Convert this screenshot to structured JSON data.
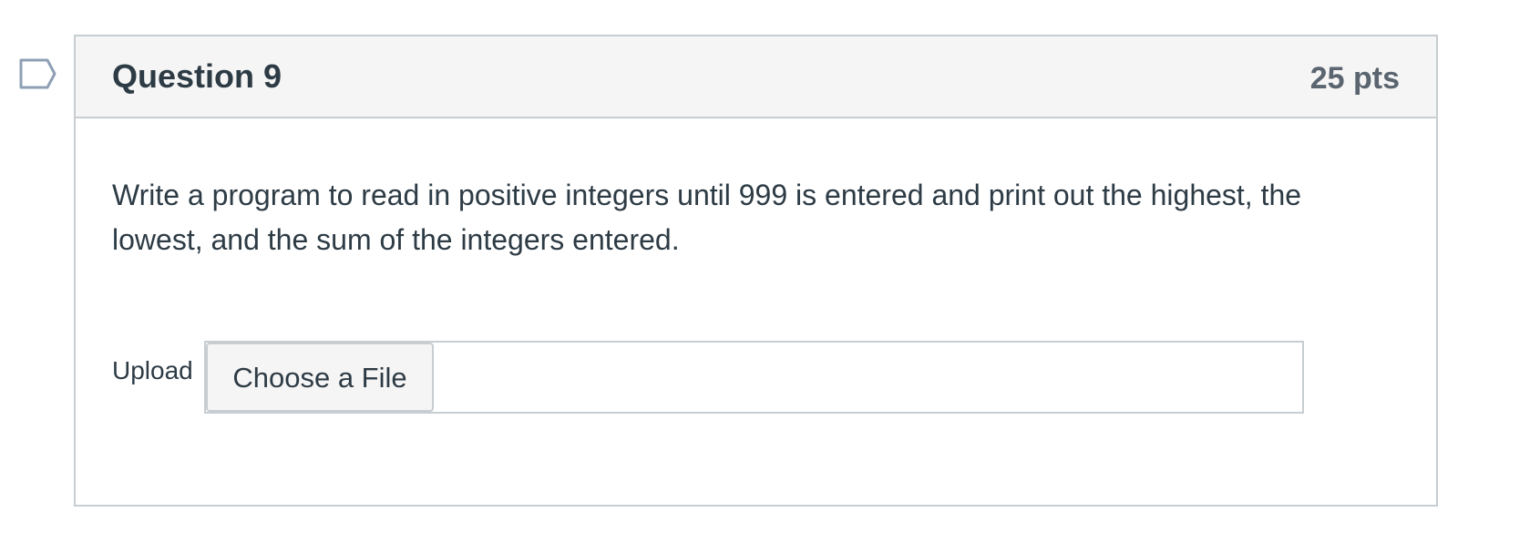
{
  "question": {
    "title": "Question 9",
    "points": "25 pts",
    "text": "Write a program to read in positive integers until 999 is entered and print out the highest, the lowest, and the sum of the integers entered.",
    "flag_icon": "bookmark-flag-icon"
  },
  "upload": {
    "label": "Upload",
    "button_label": "Choose a File"
  },
  "colors": {
    "text": "#2d3b45",
    "muted": "#5a6570",
    "border": "#c7cdd1",
    "header_bg": "#f5f5f5",
    "flag_stroke": "#8fa0b5"
  }
}
